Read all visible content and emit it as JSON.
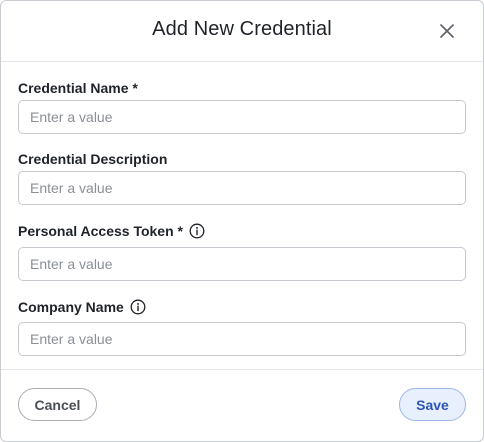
{
  "dialog": {
    "title": "Add New Credential",
    "close_icon": "close-icon"
  },
  "fields": [
    {
      "label": "Credential Name *",
      "placeholder": "Enter a value",
      "value": "",
      "info_icon": false
    },
    {
      "label": "Credential Description",
      "placeholder": "Enter a value",
      "value": "",
      "info_icon": false
    },
    {
      "label": "Personal Access Token *",
      "placeholder": "Enter a value",
      "value": "",
      "info_icon": true
    },
    {
      "label": "Company Name",
      "placeholder": "Enter a value",
      "value": "",
      "info_icon": true
    }
  ],
  "footer": {
    "cancel_label": "Cancel",
    "save_label": "Save"
  },
  "colors": {
    "save_background": "#e8f0fd",
    "save_text": "#2b56b7",
    "border": "#c6c9ce"
  },
  "icons": [
    "close-icon",
    "info-icon"
  ]
}
